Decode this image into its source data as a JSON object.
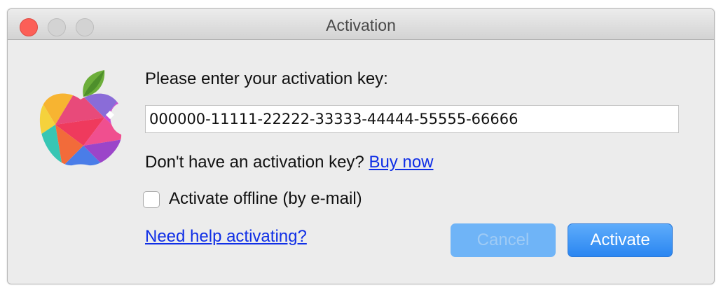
{
  "window": {
    "title": "Activation"
  },
  "form": {
    "prompt": "Please enter your activation key:",
    "key_value": "000000-11111-22222-33333-44444-55555-66666",
    "no_key_text": "Don't have an activation key?",
    "buy_link": "Buy now",
    "offline_label": "Activate offline (by e-mail)",
    "offline_checked": false,
    "help_link": "Need help activating?"
  },
  "buttons": {
    "cancel": "Cancel",
    "activate": "Activate"
  },
  "colors": {
    "close": "#fc5f57",
    "link": "#0f2ee6",
    "primary_button": "#2a86f1",
    "disabled_button": "#6fb4f7"
  },
  "icons": {
    "logo": "polygon-apple-logo-icon"
  }
}
